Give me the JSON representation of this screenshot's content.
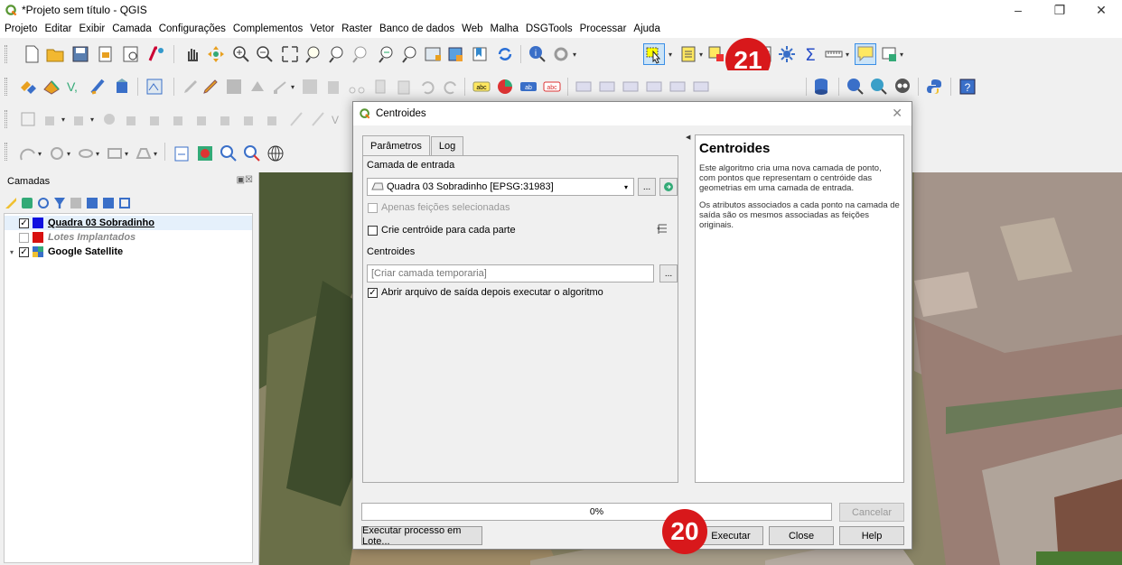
{
  "window": {
    "title": "*Projeto sem título - QGIS"
  },
  "menu": [
    "Projeto",
    "Editar",
    "Exibir",
    "Camada",
    "Configurações",
    "Complementos",
    "Vetor",
    "Raster",
    "Banco de dados",
    "Web",
    "Malha",
    "DSGTools",
    "Processar",
    "Ajuda"
  ],
  "badges": {
    "toolbar": "21",
    "run": "20"
  },
  "layers_panel": {
    "title": "Camadas",
    "layers": [
      {
        "name": "Quadra 03 Sobradinho",
        "checked": true,
        "color": "#1010e0"
      },
      {
        "name": "Lotes Implantados",
        "checked": false,
        "color": "#d81010"
      },
      {
        "name": "Google Satellite",
        "checked": true,
        "color": ""
      }
    ]
  },
  "dialog": {
    "title": "Centroides",
    "tabs": [
      "Parâmetros",
      "Log"
    ],
    "input_layer_label": "Camada de entrada",
    "input_layer_value": "Quadra 03 Sobradinho [EPSG:31983]",
    "selected_only_label": "Apenas feições selecionadas",
    "per_part_label": "Crie centróide para cada parte",
    "output_label": "Centroides",
    "output_placeholder": "[Criar camada temporaria]",
    "open_output_label": "Abrir arquivo de saída depois executar o algoritmo",
    "help_title": "Centroides",
    "help_p1": "Este algoritmo cria uma nova camada de ponto, com pontos que representam o centróide das geometrias em uma camada de entrada.",
    "help_p2": "Os atributos associados a cada ponto na camada de saída são os mesmos associadas as feições originais.",
    "progress": "0%",
    "progress_value": 0,
    "cancel": "Cancelar",
    "batch": "Executar processo em Lote...",
    "run": "Executar",
    "close": "Close",
    "help": "Help"
  }
}
